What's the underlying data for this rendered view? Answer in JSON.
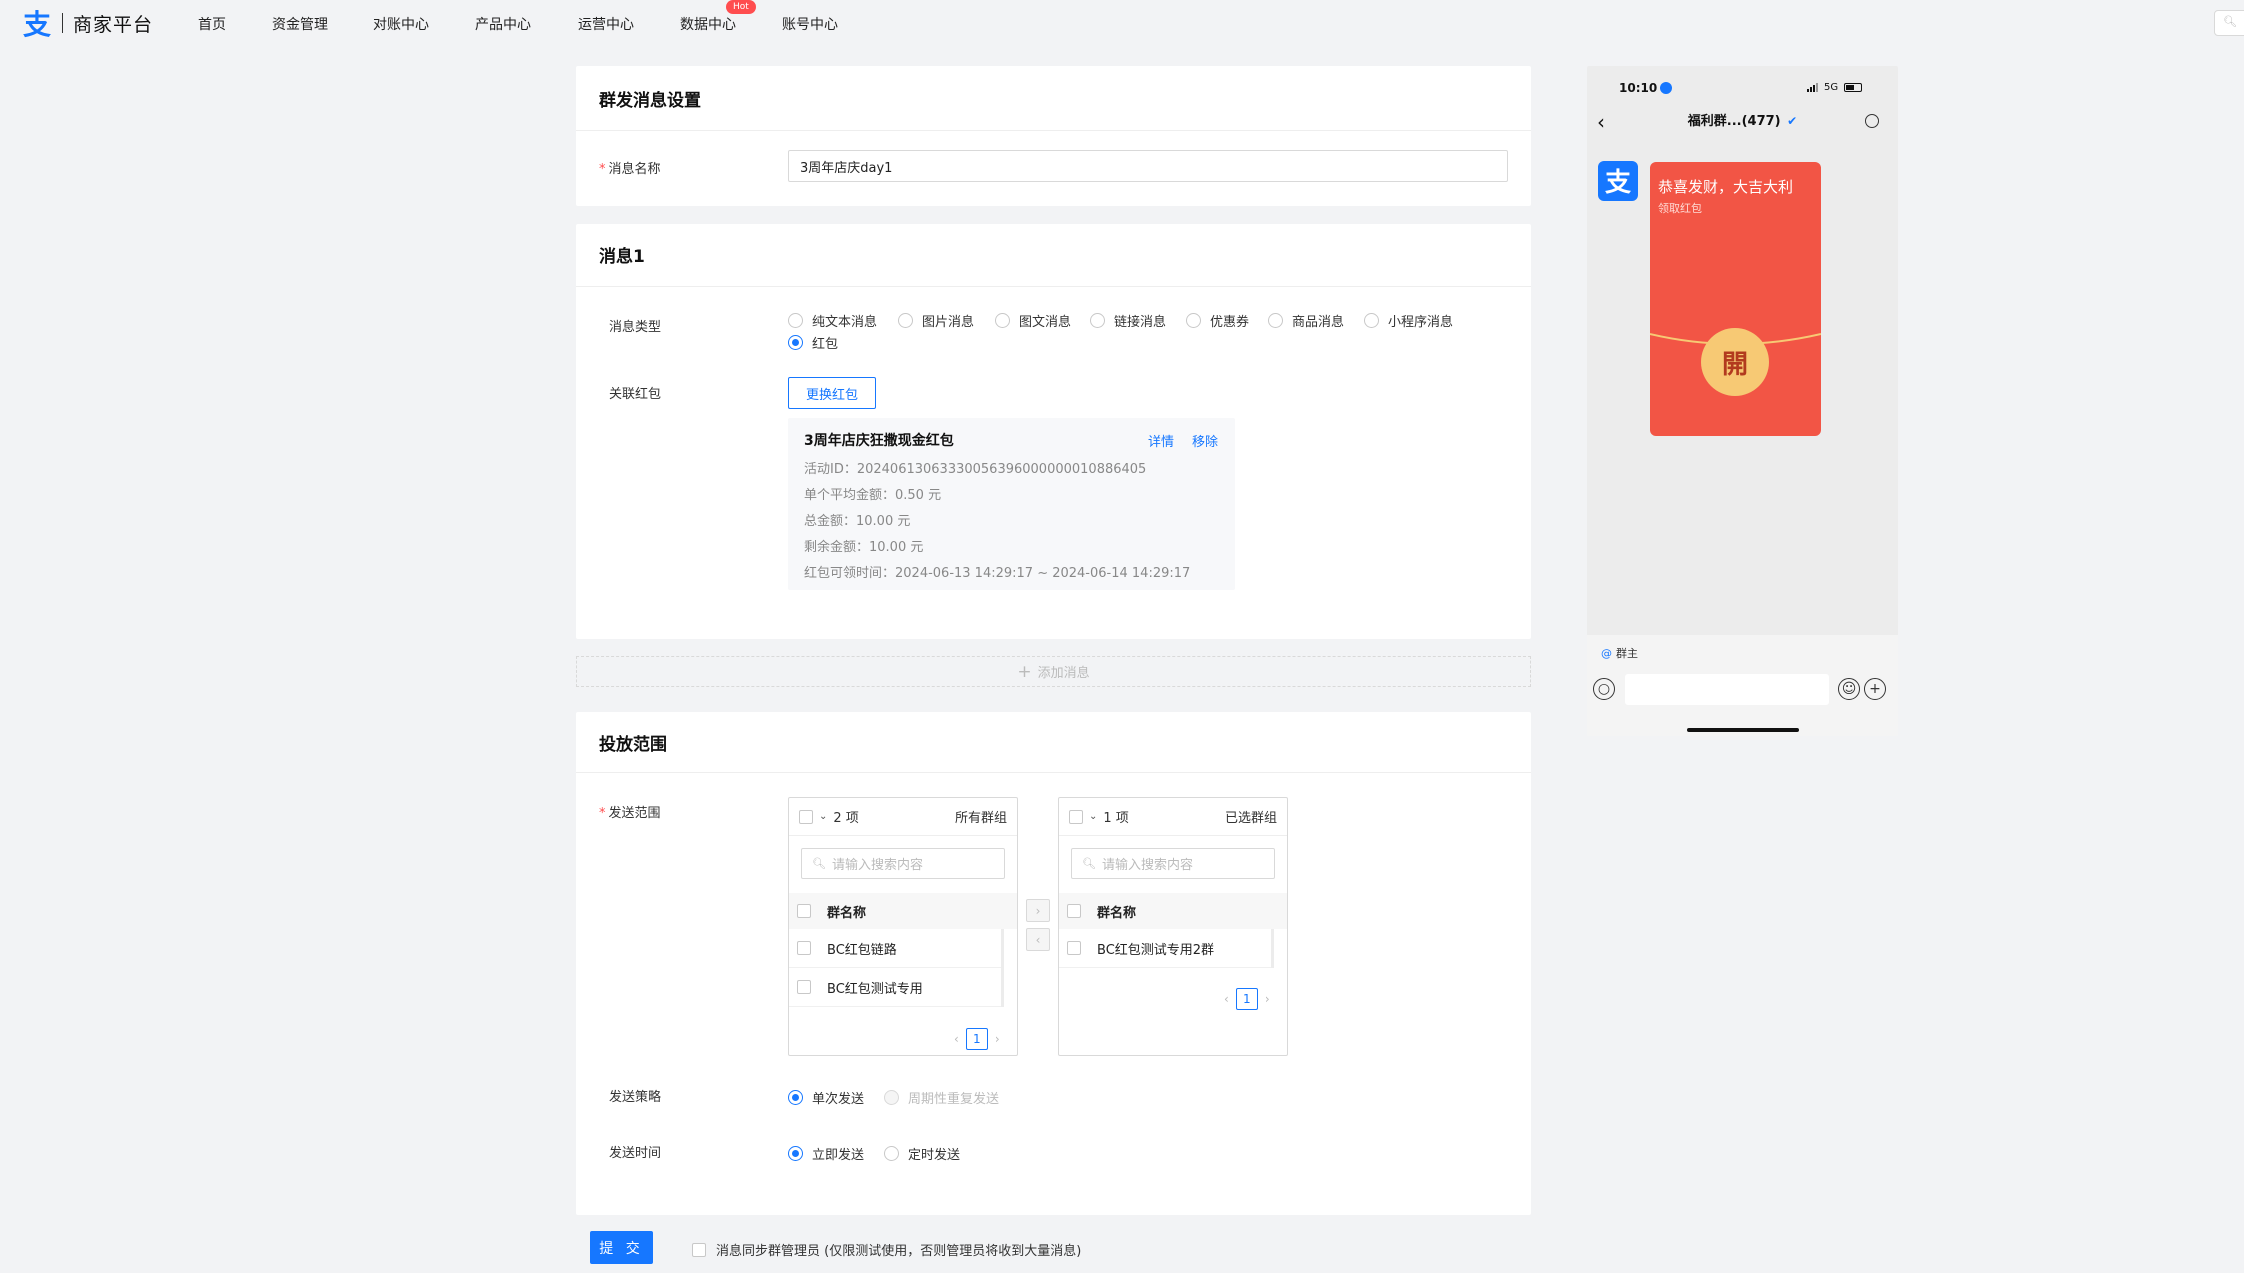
{
  "brand": {
    "name": "商家平台",
    "accent": "#1677ff"
  },
  "nav": {
    "items": [
      "首页",
      "资金管理",
      "对账中心",
      "产品中心",
      "运营中心",
      "数据中心",
      "账号中心"
    ],
    "hot_badge": "Hot"
  },
  "settings": {
    "title": "群发消息设置",
    "name_label": "消息名称",
    "name_value": "3周年店庆day1"
  },
  "message1": {
    "title": "消息1",
    "type_label": "消息类型",
    "types": [
      "纯文本消息",
      "图片消息",
      "图文消息",
      "链接消息",
      "优惠券",
      "商品消息",
      "小程序消息",
      "红包"
    ],
    "selected_type": "红包",
    "redpack_label": "关联红包",
    "change_button": "更换红包",
    "redpack": {
      "title": "3周年店庆狂撒现金红包",
      "detail_link": "详情",
      "remove_link": "移除",
      "activity_id": "活动ID：20240613063330056396000000010886405",
      "avg_amount": "单个平均金额：0.50 元",
      "total_amount": "总金额：10.00 元",
      "remaining_amount": "剩余金额：10.00 元",
      "valid_time": "红包可领时间：2024-06-13 14:29:17 ~ 2024-06-14 14:29:17"
    }
  },
  "add_message": "添加消息",
  "scope": {
    "title": "投放范围",
    "send_scope_label": "发送范围",
    "left": {
      "count": "2 项",
      "title": "所有群组",
      "search_placeholder": "请输入搜索内容",
      "column": "群名称",
      "rows": [
        "BC红包链路",
        "BC红包测试专用"
      ],
      "page": "1"
    },
    "right": {
      "count": "1 项",
      "title": "已选群组",
      "search_placeholder": "请输入搜索内容",
      "column": "群名称",
      "rows": [
        "BC红包测试专用2群"
      ],
      "page": "1"
    },
    "strategy_label": "发送策略",
    "strategy_options": [
      "单次发送",
      "周期性重复发送"
    ],
    "time_label": "发送时间",
    "time_options": [
      "立即发送",
      "定时发送"
    ]
  },
  "footer": {
    "submit": "提 交",
    "sync_label": "消息同步群管理员 (仅限测试使用，否则管理员将收到大量消息)"
  },
  "phone": {
    "time": "10:10",
    "network": "5G",
    "chat_title": "福利群...(477)",
    "redpack_wish": "恭喜发财，大吉大利",
    "redpack_sub": "领取红包",
    "open_char": "開",
    "owner_tag": "群主",
    "redpack_color": "#f25545"
  }
}
